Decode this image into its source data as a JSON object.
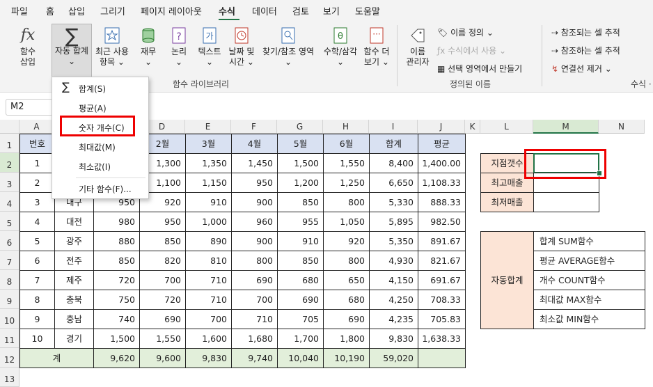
{
  "menu": [
    "파일",
    "홈",
    "삽입",
    "그리기",
    "페이지 레이아웃",
    "수식",
    "데이터",
    "검토",
    "보기",
    "도움말"
  ],
  "ribbon": {
    "insert_fn": [
      "함수",
      "삽입"
    ],
    "autosum": [
      "자동 합계",
      "⌄"
    ],
    "recent": [
      "최근 사용",
      "항목 ⌄"
    ],
    "finance": [
      "재무",
      "⌄"
    ],
    "logic": [
      "논리",
      "⌄"
    ],
    "text": [
      "텍스트",
      "⌄"
    ],
    "datetime": [
      "날짜 및",
      "시간 ⌄"
    ],
    "lookup": "찾기/참조 영역",
    "math": "수학/삼각",
    "more": [
      "함수 더",
      "보기 ⌄"
    ],
    "group_library": "함수 라이브러리",
    "name_manager": [
      "이름",
      "관리자"
    ],
    "define_name": "이름 정의",
    "use_in_formula": "수식에서 사용",
    "create_from_sel": "선택 영역에서 만들기",
    "group_names": "정의된 이름",
    "trace_precedents": "참조되는 셀 추적",
    "trace_dependents": "참조하는 셀 추적",
    "remove_arrows": "연결선 제거",
    "group_audit": "수식 ·"
  },
  "namebox": "M2",
  "columns": [
    "A",
    "B",
    "C",
    "D",
    "E",
    "F",
    "G",
    "H",
    "I",
    "J",
    "K",
    "L",
    "M",
    "N"
  ],
  "rows": [
    "1",
    "2",
    "3",
    "4",
    "5",
    "6",
    "7",
    "8",
    "9",
    "10",
    "11",
    "12",
    "13"
  ],
  "table": {
    "header": [
      "번호",
      "",
      "",
      "2월",
      "3월",
      "4월",
      "5월",
      "6월",
      "합계",
      "평균"
    ],
    "rows": [
      [
        "1",
        "",
        "",
        "1,300",
        "1,350",
        "1,450",
        "1,500",
        "1,550",
        "8,400",
        "1,400.00"
      ],
      [
        "2",
        "",
        "",
        "1,100",
        "1,150",
        "950",
        "1,200",
        "1,250",
        "6,650",
        "1,108.33"
      ],
      [
        "3",
        "내구",
        "950",
        "920",
        "910",
        "900",
        "850",
        "800",
        "5,330",
        "888.33"
      ],
      [
        "4",
        "대전",
        "980",
        "950",
        "1,000",
        "960",
        "955",
        "1,050",
        "5,895",
        "982.50"
      ],
      [
        "5",
        "광주",
        "880",
        "850",
        "890",
        "900",
        "910",
        "920",
        "5,350",
        "891.67"
      ],
      [
        "6",
        "전주",
        "850",
        "820",
        "810",
        "800",
        "850",
        "800",
        "4,930",
        "821.67"
      ],
      [
        "7",
        "제주",
        "720",
        "700",
        "710",
        "690",
        "680",
        "650",
        "4,150",
        "691.67"
      ],
      [
        "8",
        "충북",
        "750",
        "720",
        "710",
        "700",
        "690",
        "680",
        "4,250",
        "708.33"
      ],
      [
        "9",
        "충남",
        "740",
        "690",
        "700",
        "710",
        "705",
        "690",
        "4,235",
        "705.83"
      ],
      [
        "10",
        "경기",
        "1,500",
        "1,550",
        "1,600",
        "1,680",
        "1,700",
        "1,800",
        "9,830",
        "1,638.33"
      ]
    ],
    "total": [
      "계",
      "9,620",
      "9,600",
      "9,830",
      "9,740",
      "10,040",
      "10,190",
      "59,020",
      ""
    ]
  },
  "side_labels": [
    "지점갯수",
    "최고매출",
    "최저매출"
  ],
  "autosum_label": "자동합계",
  "autosum_items": [
    "합계 SUM함수",
    "평균 AVERAGE함수",
    "개수 COUNT함수",
    "최대값 MAX함수",
    "최소값 MIN함수"
  ],
  "dropdown": {
    "items": [
      "합계(S)",
      "평균(A)",
      "숫자 개수(C)",
      "최대값(M)",
      "최소값(I)",
      "기타 함수(F)..."
    ]
  },
  "colors": {
    "accent": "#217346",
    "highlight": "#e00000",
    "header_fill": "#d9e1f2",
    "total_fill": "#e2efda",
    "label_fill": "#fce4d6"
  }
}
